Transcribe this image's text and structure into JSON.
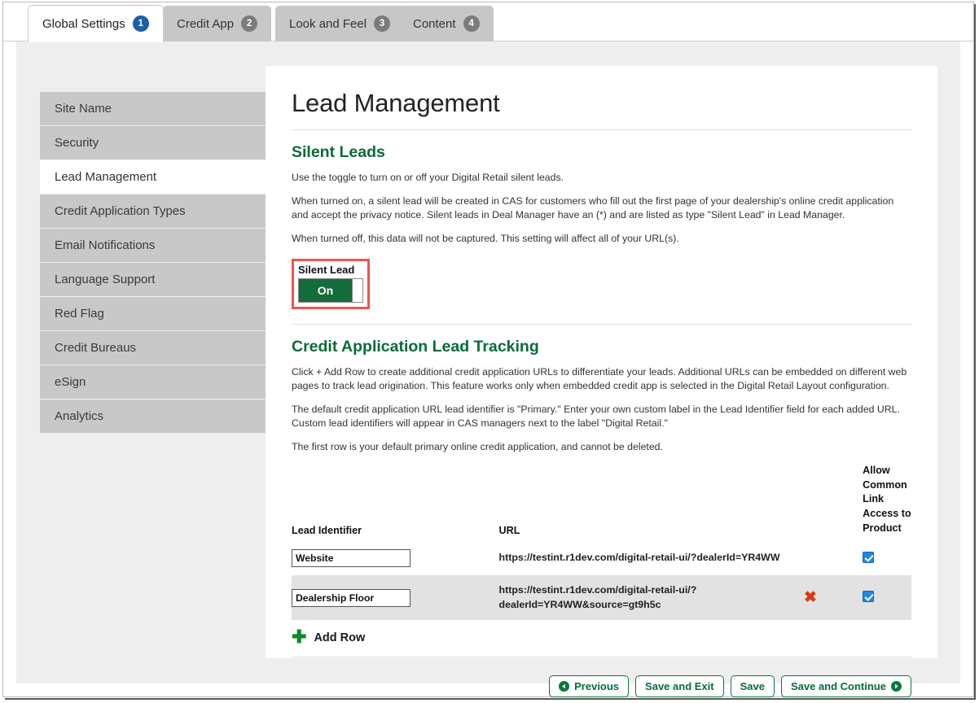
{
  "tabs": [
    {
      "label": "Global Settings",
      "badge": "1",
      "active": true
    },
    {
      "label": "Credit App",
      "badge": "2",
      "active": false
    },
    {
      "label": "Look and Feel",
      "badge": "3",
      "active": false
    },
    {
      "label": "Content",
      "badge": "4",
      "active": false
    }
  ],
  "sidebar": {
    "items": [
      {
        "label": "Site Name"
      },
      {
        "label": "Security"
      },
      {
        "label": "Lead Management"
      },
      {
        "label": "Credit Application Types"
      },
      {
        "label": "Email Notifications"
      },
      {
        "label": "Language Support"
      },
      {
        "label": "Red Flag"
      },
      {
        "label": "Credit Bureaus"
      },
      {
        "label": "eSign"
      },
      {
        "label": "Analytics"
      }
    ]
  },
  "main": {
    "title": "Lead Management",
    "silent_leads": {
      "heading": "Silent Leads",
      "p1": "Use the toggle to turn on or off your Digital Retail silent leads.",
      "p2": "When turned on, a silent lead will be created in CAS for customers who fill out the first page of your dealership's online credit application and accept the privacy notice. Silent leads in Deal Manager have an (*) and are listed as type \"Silent Lead\" in Lead Manager.",
      "p3": "When turned off, this data will not be captured. This setting will affect all of your URL(s).",
      "toggle_label": "Silent Lead",
      "toggle_state": "On"
    },
    "tracking": {
      "heading": "Credit Application Lead Tracking",
      "p1": "Click + Add Row to create additional credit application URLs to differentiate your leads. Additional URLs can be embedded on different web pages to track lead origination. This feature works only when embedded credit app is selected in the Digital Retail Layout configuration.",
      "p2": "The default credit application URL lead identifier is \"Primary.\" Enter your own custom label in the Lead Identifier field for each added URL. Custom lead identifiers will appear in CAS managers next to the label \"Digital Retail.\"",
      "p3": "The first row is your default primary online credit application, and cannot be deleted.",
      "columns": {
        "lead_identifier": "Lead Identifier",
        "url": "URL",
        "allow": "Allow Common Link Access to Product"
      },
      "rows": [
        {
          "lead_identifier": "Website",
          "url": "https://testint.r1dev.com/digital-retail-ui/?dealerId=YR4WW",
          "deletable": false,
          "allow_checked": true
        },
        {
          "lead_identifier": "Dealership Floor",
          "url": "https://testint.r1dev.com/digital-retail-ui/?dealerId=YR4WW&source=gt9h5c",
          "deletable": true,
          "allow_checked": true
        }
      ],
      "add_row_label": "Add Row",
      "delete_icon": "✖"
    },
    "buttons": {
      "previous": "Previous",
      "save_and_exit": "Save and Exit",
      "save": "Save",
      "save_and_continue": "Save and Continue"
    }
  },
  "colors": {
    "green": "#0a6b39",
    "toggle_green": "#146c3a",
    "highlight_red": "#ef5350",
    "badge_active_blue": "#1a5fa8",
    "badge_inactive_gray": "#7b7b7b",
    "checkbox_blue": "#1e88e5",
    "delete_red": "#d93a10"
  }
}
